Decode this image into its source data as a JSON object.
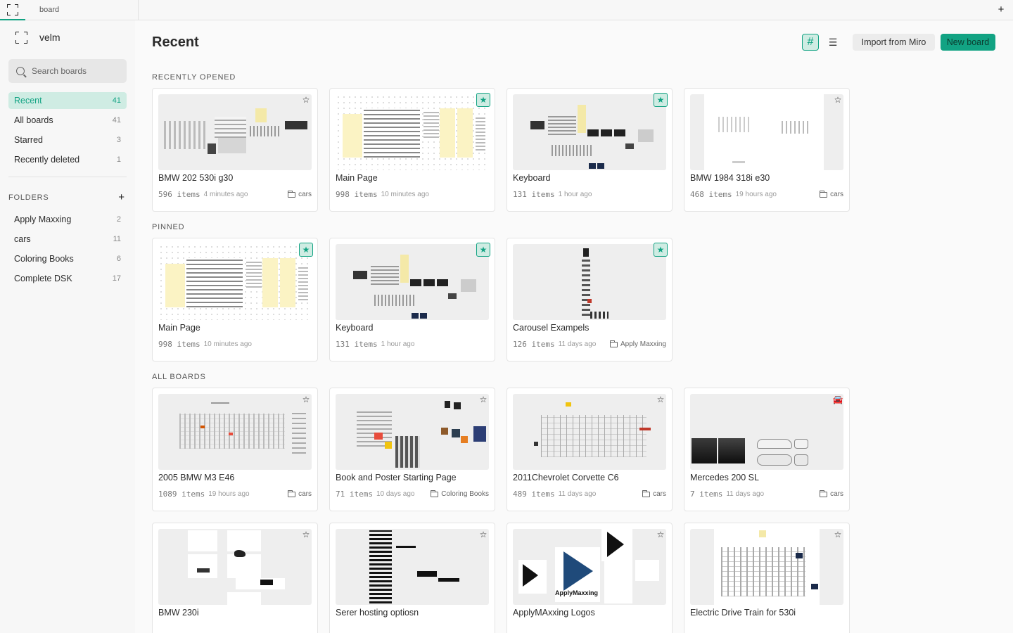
{
  "topbar": {
    "tab_label": "board",
    "new_tab_symbol": "+"
  },
  "sidebar": {
    "brand": "velm",
    "search_placeholder": "Search boards",
    "nav": [
      {
        "label": "Recent",
        "count": "41"
      },
      {
        "label": "All boards",
        "count": "41"
      },
      {
        "label": "Starred",
        "count": "3"
      },
      {
        "label": "Recently deleted",
        "count": "1"
      }
    ],
    "folders_label": "FOLDERS",
    "add_folder_symbol": "+",
    "folders": [
      {
        "label": "Apply Maxxing",
        "count": "2"
      },
      {
        "label": "cars",
        "count": "11"
      },
      {
        "label": "Coloring Books",
        "count": "6"
      },
      {
        "label": "Complete DSK",
        "count": "17"
      }
    ]
  },
  "main": {
    "title": "Recent",
    "import_label": "Import from Miro",
    "new_board_label": "New board",
    "sections": {
      "recently_opened": "RECENTLY OPENED",
      "pinned": "PINNED",
      "all_boards": "ALL BOARDS"
    },
    "recently_opened": [
      {
        "title": "BMW 202 530i g30",
        "items": "596  items",
        "ago": "4 minutes ago",
        "folder": "cars",
        "starred": false
      },
      {
        "title": "Main Page",
        "items": "998  items",
        "ago": "10 minutes ago",
        "folder": "",
        "starred": true
      },
      {
        "title": "Keyboard",
        "items": "131  items",
        "ago": "1 hour ago",
        "folder": "",
        "starred": true
      },
      {
        "title": "BMW 1984 318i e30",
        "items": "468  items",
        "ago": "19 hours ago",
        "folder": "cars",
        "starred": false
      }
    ],
    "pinned": [
      {
        "title": "Main Page",
        "items": "998  items",
        "ago": "10 minutes ago",
        "folder": "",
        "starred": true
      },
      {
        "title": "Keyboard",
        "items": "131  items",
        "ago": "1 hour ago",
        "folder": "",
        "starred": true
      },
      {
        "title": "Carousel Exampels",
        "items": "126  items",
        "ago": "11 days ago",
        "folder": "Apply Maxxing",
        "starred": true
      }
    ],
    "all_boards": [
      {
        "title": "2005 BMW M3 E46",
        "items": "1089  items",
        "ago": "19 hours ago",
        "folder": "cars",
        "starred": false
      },
      {
        "title": "Book and Poster Starting Page",
        "items": "71  items",
        "ago": "10 days ago",
        "folder": "Coloring Books",
        "starred": false
      },
      {
        "title": "2011Chevrolet Corvette C6",
        "items": "489  items",
        "ago": "11 days ago",
        "folder": "cars",
        "starred": false
      },
      {
        "title": "Mercedes 200 SL",
        "items": "7  items",
        "ago": "11 days ago",
        "folder": "cars",
        "starred": false
      },
      {
        "title": "BMW 230i",
        "starred": false
      },
      {
        "title": "Serer hosting optiosn",
        "starred": false
      },
      {
        "title": "ApplyMAxxing Logos",
        "starred": false
      },
      {
        "title": "Electric Drive Train for 530i",
        "starred": false
      }
    ],
    "thumb_text": {
      "apply_maxxing": "ApplyMaxxing"
    }
  },
  "colors": {
    "accent": "#12a383",
    "accent_soft": "#cfece3",
    "star_note": "#fbf3c4"
  }
}
